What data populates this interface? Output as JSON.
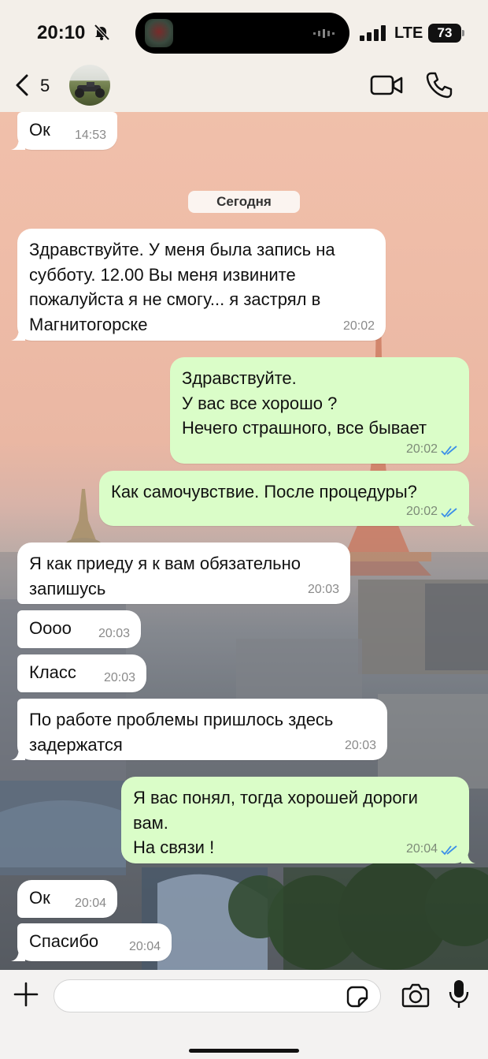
{
  "status_bar": {
    "time": "20:10",
    "network": "LTE",
    "battery": "73"
  },
  "header": {
    "back_count": "5"
  },
  "date_separator": "Сегодня",
  "messages": [
    {
      "direction": "in",
      "text": "Ок",
      "time": "14:53"
    },
    {
      "direction": "in",
      "text": "Здравствуйте. У меня была запись на\nсубботу. 12.00 Вы меня извините\nпожалуйста я не смогу... я застрял в\nМагнитогорске",
      "time": "20:02"
    },
    {
      "direction": "out",
      "text": "Здравствуйте.\nУ вас все хорошо ?\nНечего страшного, все бывает",
      "time": "20:02",
      "status": "read"
    },
    {
      "direction": "out",
      "text": "Как самочувствие. После процедуры?",
      "time": "20:02",
      "status": "read"
    },
    {
      "direction": "in",
      "text": "Я как приеду я к вам обязательно\nзапишусь",
      "time": "20:03"
    },
    {
      "direction": "in",
      "text": "Оооо",
      "time": "20:03"
    },
    {
      "direction": "in",
      "text": "Класс",
      "time": "20:03"
    },
    {
      "direction": "in",
      "text": "По работе проблемы пришлось здесь\nзадержатся",
      "time": "20:03"
    },
    {
      "direction": "out",
      "text": "Я вас понял, тогда хорошей дороги\nвам.\nНа связи !",
      "time": "20:04",
      "status": "read"
    },
    {
      "direction": "in",
      "text": "Ок",
      "time": "20:04"
    },
    {
      "direction": "in",
      "text": "Спасибо",
      "time": "20:04"
    }
  ],
  "composer": {
    "value": "",
    "placeholder": ""
  },
  "icons": {
    "status": [
      "bell-slash-icon",
      "signal-icon",
      "battery-icon"
    ],
    "header": [
      "chevron-left-icon",
      "video-camera-icon",
      "phone-icon"
    ],
    "composer": [
      "plus-icon",
      "sticker-icon",
      "camera-icon",
      "microphone-icon"
    ],
    "read_receipt": "double-check-icon"
  },
  "colors": {
    "incoming_bubble": "#ffffff",
    "outgoing_bubble": "#dafdc8",
    "read_tick": "#3b8fe8",
    "header_bg": "#f3efe9"
  }
}
